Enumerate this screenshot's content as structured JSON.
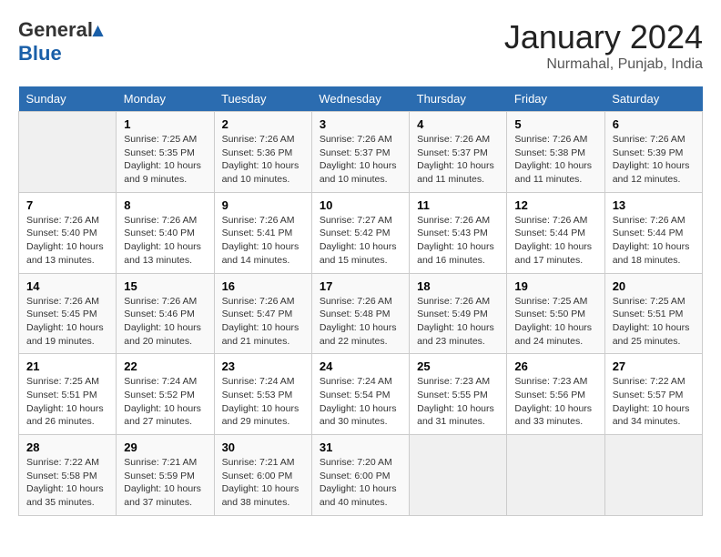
{
  "header": {
    "logo_general": "General",
    "logo_blue": "Blue",
    "month_title": "January 2024",
    "location": "Nurmahal, Punjab, India"
  },
  "weekdays": [
    "Sunday",
    "Monday",
    "Tuesday",
    "Wednesday",
    "Thursday",
    "Friday",
    "Saturday"
  ],
  "weeks": [
    [
      {
        "day": "",
        "info": ""
      },
      {
        "day": "1",
        "info": "Sunrise: 7:25 AM\nSunset: 5:35 PM\nDaylight: 10 hours\nand 9 minutes."
      },
      {
        "day": "2",
        "info": "Sunrise: 7:26 AM\nSunset: 5:36 PM\nDaylight: 10 hours\nand 10 minutes."
      },
      {
        "day": "3",
        "info": "Sunrise: 7:26 AM\nSunset: 5:37 PM\nDaylight: 10 hours\nand 10 minutes."
      },
      {
        "day": "4",
        "info": "Sunrise: 7:26 AM\nSunset: 5:37 PM\nDaylight: 10 hours\nand 11 minutes."
      },
      {
        "day": "5",
        "info": "Sunrise: 7:26 AM\nSunset: 5:38 PM\nDaylight: 10 hours\nand 11 minutes."
      },
      {
        "day": "6",
        "info": "Sunrise: 7:26 AM\nSunset: 5:39 PM\nDaylight: 10 hours\nand 12 minutes."
      }
    ],
    [
      {
        "day": "7",
        "info": "Sunrise: 7:26 AM\nSunset: 5:40 PM\nDaylight: 10 hours\nand 13 minutes."
      },
      {
        "day": "8",
        "info": "Sunrise: 7:26 AM\nSunset: 5:40 PM\nDaylight: 10 hours\nand 13 minutes."
      },
      {
        "day": "9",
        "info": "Sunrise: 7:26 AM\nSunset: 5:41 PM\nDaylight: 10 hours\nand 14 minutes."
      },
      {
        "day": "10",
        "info": "Sunrise: 7:27 AM\nSunset: 5:42 PM\nDaylight: 10 hours\nand 15 minutes."
      },
      {
        "day": "11",
        "info": "Sunrise: 7:26 AM\nSunset: 5:43 PM\nDaylight: 10 hours\nand 16 minutes."
      },
      {
        "day": "12",
        "info": "Sunrise: 7:26 AM\nSunset: 5:44 PM\nDaylight: 10 hours\nand 17 minutes."
      },
      {
        "day": "13",
        "info": "Sunrise: 7:26 AM\nSunset: 5:44 PM\nDaylight: 10 hours\nand 18 minutes."
      }
    ],
    [
      {
        "day": "14",
        "info": "Sunrise: 7:26 AM\nSunset: 5:45 PM\nDaylight: 10 hours\nand 19 minutes."
      },
      {
        "day": "15",
        "info": "Sunrise: 7:26 AM\nSunset: 5:46 PM\nDaylight: 10 hours\nand 20 minutes."
      },
      {
        "day": "16",
        "info": "Sunrise: 7:26 AM\nSunset: 5:47 PM\nDaylight: 10 hours\nand 21 minutes."
      },
      {
        "day": "17",
        "info": "Sunrise: 7:26 AM\nSunset: 5:48 PM\nDaylight: 10 hours\nand 22 minutes."
      },
      {
        "day": "18",
        "info": "Sunrise: 7:26 AM\nSunset: 5:49 PM\nDaylight: 10 hours\nand 23 minutes."
      },
      {
        "day": "19",
        "info": "Sunrise: 7:25 AM\nSunset: 5:50 PM\nDaylight: 10 hours\nand 24 minutes."
      },
      {
        "day": "20",
        "info": "Sunrise: 7:25 AM\nSunset: 5:51 PM\nDaylight: 10 hours\nand 25 minutes."
      }
    ],
    [
      {
        "day": "21",
        "info": "Sunrise: 7:25 AM\nSunset: 5:51 PM\nDaylight: 10 hours\nand 26 minutes."
      },
      {
        "day": "22",
        "info": "Sunrise: 7:24 AM\nSunset: 5:52 PM\nDaylight: 10 hours\nand 27 minutes."
      },
      {
        "day": "23",
        "info": "Sunrise: 7:24 AM\nSunset: 5:53 PM\nDaylight: 10 hours\nand 29 minutes."
      },
      {
        "day": "24",
        "info": "Sunrise: 7:24 AM\nSunset: 5:54 PM\nDaylight: 10 hours\nand 30 minutes."
      },
      {
        "day": "25",
        "info": "Sunrise: 7:23 AM\nSunset: 5:55 PM\nDaylight: 10 hours\nand 31 minutes."
      },
      {
        "day": "26",
        "info": "Sunrise: 7:23 AM\nSunset: 5:56 PM\nDaylight: 10 hours\nand 33 minutes."
      },
      {
        "day": "27",
        "info": "Sunrise: 7:22 AM\nSunset: 5:57 PM\nDaylight: 10 hours\nand 34 minutes."
      }
    ],
    [
      {
        "day": "28",
        "info": "Sunrise: 7:22 AM\nSunset: 5:58 PM\nDaylight: 10 hours\nand 35 minutes."
      },
      {
        "day": "29",
        "info": "Sunrise: 7:21 AM\nSunset: 5:59 PM\nDaylight: 10 hours\nand 37 minutes."
      },
      {
        "day": "30",
        "info": "Sunrise: 7:21 AM\nSunset: 6:00 PM\nDaylight: 10 hours\nand 38 minutes."
      },
      {
        "day": "31",
        "info": "Sunrise: 7:20 AM\nSunset: 6:00 PM\nDaylight: 10 hours\nand 40 minutes."
      },
      {
        "day": "",
        "info": ""
      },
      {
        "day": "",
        "info": ""
      },
      {
        "day": "",
        "info": ""
      }
    ]
  ]
}
